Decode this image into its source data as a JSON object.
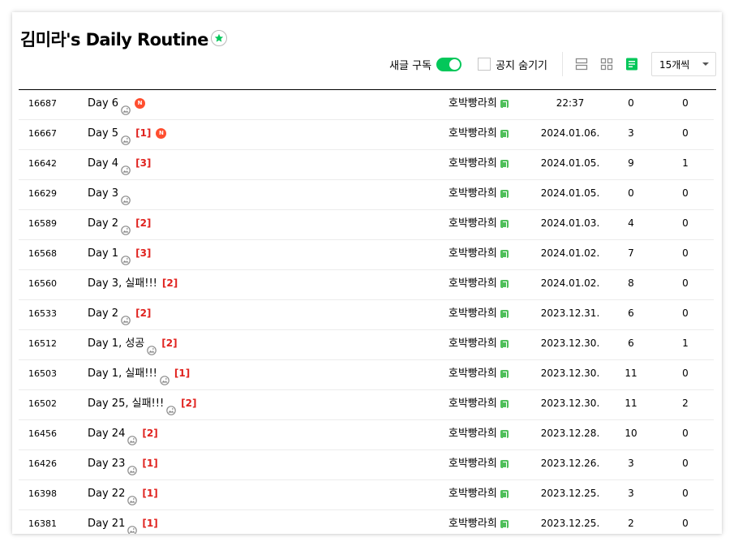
{
  "header": {
    "title": "김미라's Daily Routine",
    "favorite_icon": "star-icon"
  },
  "toolbar": {
    "subscribe_label": "새글 구독",
    "subscribe_on": true,
    "hide_notice_label": "공지 숨기기",
    "hide_notice_checked": false,
    "view_modes": [
      "card-view-icon",
      "album-view-icon",
      "list-view-icon"
    ],
    "active_view": "list-view-icon",
    "page_size": "15개씩"
  },
  "colors": {
    "accent": "#03c75a",
    "comment_count": "#e0221e",
    "new_badge": "#ff4e2f",
    "level_icon": "#4fbf5a"
  },
  "posts": [
    {
      "no": "16687",
      "title": "Day 6",
      "image": true,
      "comments": "",
      "is_new": true,
      "author": "호박빵라희",
      "date": "22:37",
      "views": "0",
      "likes": "0"
    },
    {
      "no": "16667",
      "title": "Day 5",
      "image": true,
      "comments": "[1]",
      "is_new": true,
      "author": "호박빵라희",
      "date": "2024.01.06.",
      "views": "3",
      "likes": "0"
    },
    {
      "no": "16642",
      "title": "Day 4",
      "image": true,
      "comments": "[3]",
      "is_new": false,
      "author": "호박빵라희",
      "date": "2024.01.05.",
      "views": "9",
      "likes": "1"
    },
    {
      "no": "16629",
      "title": "Day 3",
      "image": true,
      "comments": "",
      "is_new": false,
      "author": "호박빵라희",
      "date": "2024.01.05.",
      "views": "0",
      "likes": "0"
    },
    {
      "no": "16589",
      "title": "Day 2",
      "image": true,
      "comments": "[2]",
      "is_new": false,
      "author": "호박빵라희",
      "date": "2024.01.03.",
      "views": "4",
      "likes": "0"
    },
    {
      "no": "16568",
      "title": "Day 1",
      "image": true,
      "comments": "[3]",
      "is_new": false,
      "author": "호박빵라희",
      "date": "2024.01.02.",
      "views": "7",
      "likes": "0"
    },
    {
      "no": "16560",
      "title": "Day 3, 실패!!!",
      "image": false,
      "comments": "[2]",
      "is_new": false,
      "author": "호박빵라희",
      "date": "2024.01.02.",
      "views": "8",
      "likes": "0"
    },
    {
      "no": "16533",
      "title": "Day 2",
      "image": true,
      "comments": "[2]",
      "is_new": false,
      "author": "호박빵라희",
      "date": "2023.12.31.",
      "views": "6",
      "likes": "0"
    },
    {
      "no": "16512",
      "title": "Day 1, 성공",
      "image": true,
      "comments": "[2]",
      "is_new": false,
      "author": "호박빵라희",
      "date": "2023.12.30.",
      "views": "6",
      "likes": "1"
    },
    {
      "no": "16503",
      "title": "Day 1, 실패!!!",
      "image": true,
      "comments": "[1]",
      "is_new": false,
      "author": "호박빵라희",
      "date": "2023.12.30.",
      "views": "11",
      "likes": "0"
    },
    {
      "no": "16502",
      "title": "Day 25, 실패!!!",
      "image": true,
      "comments": "[2]",
      "is_new": false,
      "author": "호박빵라희",
      "date": "2023.12.30.",
      "views": "11",
      "likes": "2"
    },
    {
      "no": "16456",
      "title": "Day 24",
      "image": true,
      "comments": "[2]",
      "is_new": false,
      "author": "호박빵라희",
      "date": "2023.12.28.",
      "views": "10",
      "likes": "0"
    },
    {
      "no": "16426",
      "title": "Day 23",
      "image": true,
      "comments": "[1]",
      "is_new": false,
      "author": "호박빵라희",
      "date": "2023.12.26.",
      "views": "3",
      "likes": "0"
    },
    {
      "no": "16398",
      "title": "Day 22",
      "image": true,
      "comments": "[1]",
      "is_new": false,
      "author": "호박빵라희",
      "date": "2023.12.25.",
      "views": "3",
      "likes": "0"
    },
    {
      "no": "16381",
      "title": "Day 21",
      "image": true,
      "comments": "[1]",
      "is_new": false,
      "author": "호박빵라희",
      "date": "2023.12.25.",
      "views": "2",
      "likes": "0"
    }
  ]
}
